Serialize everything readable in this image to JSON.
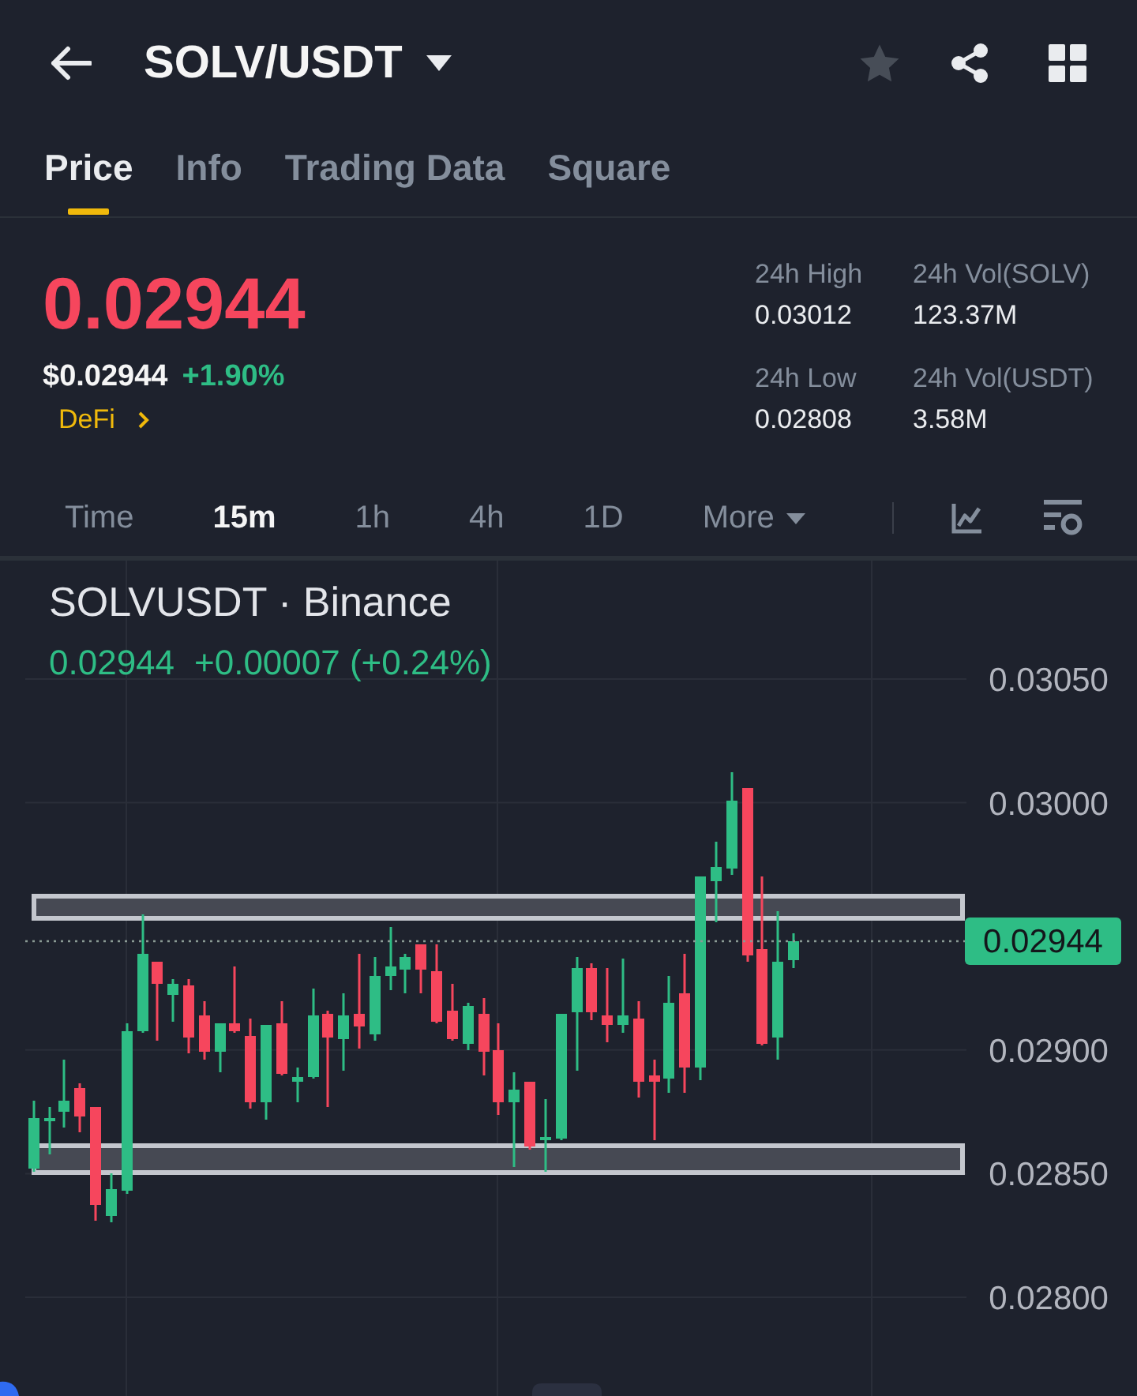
{
  "header": {
    "title": "SOLV/USDT",
    "favorite": false
  },
  "tabs": [
    {
      "label": "Price",
      "selected": true
    },
    {
      "label": "Info",
      "selected": false
    },
    {
      "label": "Trading Data",
      "selected": false
    },
    {
      "label": "Square",
      "selected": false
    }
  ],
  "ticker": {
    "price": "0.02944",
    "price_up": false,
    "usd_price": "$0.02944",
    "change": "+1.90%",
    "change_up": true,
    "category": "DeFi"
  },
  "stats": [
    {
      "label": "24h High",
      "value": "0.03012"
    },
    {
      "label": "24h Vol(SOLV)",
      "value": "123.37M"
    },
    {
      "label": "24h Low",
      "value": "0.02808"
    },
    {
      "label": "24h Vol(USDT)",
      "value": "3.58M"
    }
  ],
  "intervals": [
    {
      "label": "Time",
      "kind": "option",
      "selected": false
    },
    {
      "label": "15m",
      "kind": "option",
      "selected": true
    },
    {
      "label": "1h",
      "kind": "option",
      "selected": false
    },
    {
      "label": "4h",
      "kind": "option",
      "selected": false
    },
    {
      "label": "1D",
      "kind": "option",
      "selected": false
    },
    {
      "label": "More",
      "kind": "menu",
      "selected": false
    }
  ],
  "chart": {
    "title": "SOLVUSDT · Binance",
    "last_price": "0.02944",
    "change": "+0.00007 (+0.24%)",
    "up": true,
    "price_labels": [
      "0.03050",
      "0.03000",
      "0.02900",
      "0.02850",
      "0.02800"
    ],
    "price_tag": "0.02944"
  }
}
